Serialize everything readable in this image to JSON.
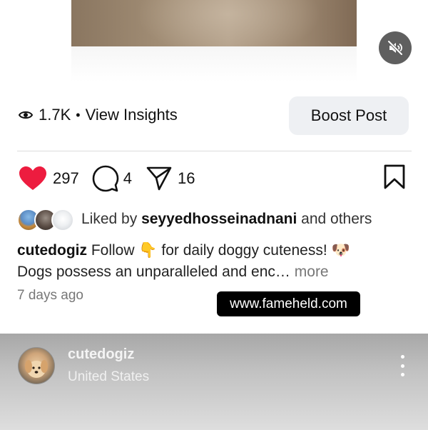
{
  "media": {
    "mute_icon": "speaker-muted-icon"
  },
  "insights": {
    "eye_icon": "eye-icon",
    "views": "1.7K",
    "separator": "•",
    "link_label": "View Insights"
  },
  "boost": {
    "label": "Boost Post"
  },
  "actions": {
    "like_icon": "heart-filled-icon",
    "like_color": "#ed1c3f",
    "like_count": "297",
    "comment_icon": "comment-icon",
    "comment_count": "4",
    "share_icon": "paper-plane-icon",
    "share_count": "16",
    "save_icon": "bookmark-icon"
  },
  "liked_by": {
    "prefix": "Liked by",
    "username": "seyyedhosseinadnani",
    "suffix": "and others"
  },
  "caption": {
    "username": "cutedogiz",
    "text_1": "Follow",
    "emoji_point": "👇",
    "text_2": "for daily doggy cuteness!",
    "emoji_dog": "🐶",
    "line_2": "Dogs possess an unparalleled and enc…",
    "more_label": "more"
  },
  "time_ago": "7 days ago",
  "watermark": "www.fameheld.com",
  "next_post": {
    "username": "cutedogiz",
    "location": "United States",
    "menu_icon": "more-vertical-icon"
  }
}
